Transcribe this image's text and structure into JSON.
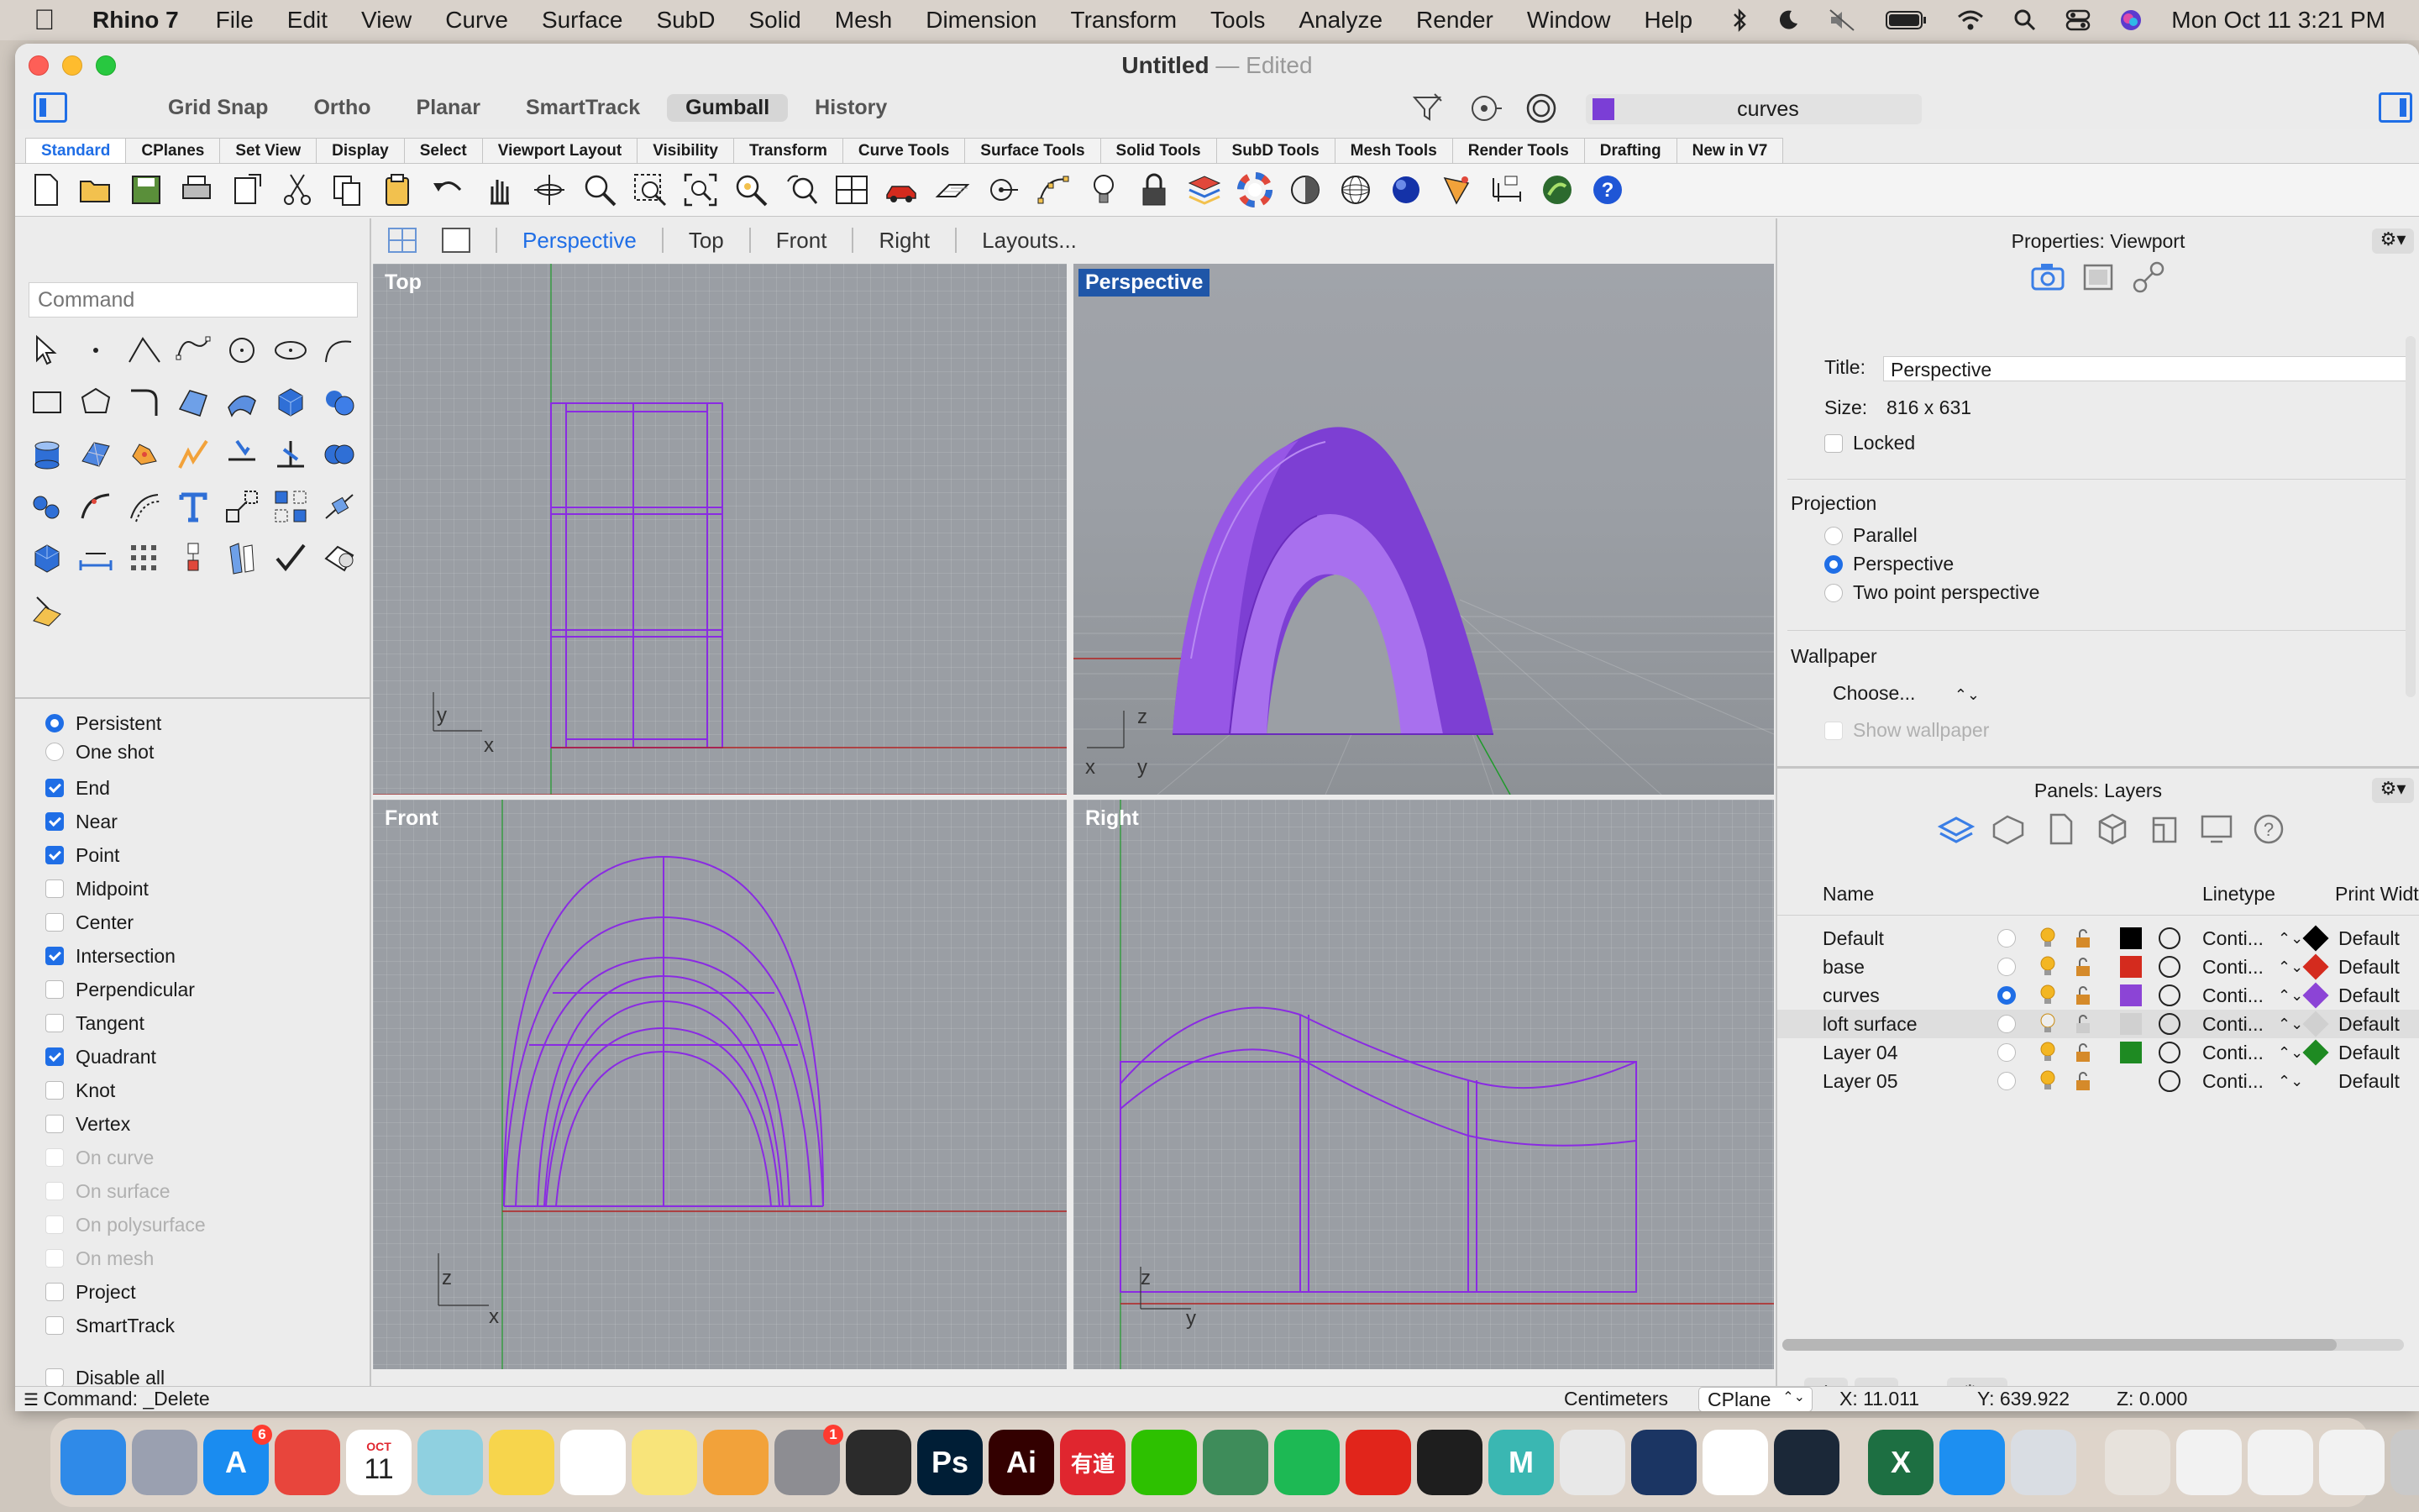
{
  "menubar": {
    "app_name": "Rhino 7",
    "items": [
      "File",
      "Edit",
      "View",
      "Curve",
      "Surface",
      "SubD",
      "Solid",
      "Mesh",
      "Dimension",
      "Transform",
      "Tools",
      "Analyze",
      "Render",
      "Window",
      "Help"
    ],
    "clock": "Mon Oct 11  3:21 PM"
  },
  "window": {
    "title": "Untitled",
    "edited": "— Edited",
    "toggles": [
      {
        "label": "Grid Snap",
        "active": false
      },
      {
        "label": "Ortho",
        "active": false
      },
      {
        "label": "Planar",
        "active": false
      },
      {
        "label": "SmartTrack",
        "active": false
      },
      {
        "label": "Gumball",
        "active": true
      },
      {
        "label": "History",
        "active": false
      }
    ],
    "current_layer": "curves",
    "current_layer_color": "#7b3ed6"
  },
  "tabs": [
    "Standard",
    "CPlanes",
    "Set View",
    "Display",
    "Select",
    "Viewport Layout",
    "Visibility",
    "Transform",
    "Curve Tools",
    "Surface Tools",
    "Solid Tools",
    "SubD Tools",
    "Mesh Tools",
    "Render Tools",
    "Drafting",
    "New in V7"
  ],
  "active_tab": "Standard",
  "command": {
    "placeholder": "Command",
    "last_command": "Command: _Delete"
  },
  "osnap": {
    "mode": [
      {
        "label": "Persistent",
        "on": true
      },
      {
        "label": "One shot",
        "on": false
      }
    ],
    "items": [
      {
        "label": "End",
        "on": true,
        "disabled": false
      },
      {
        "label": "Near",
        "on": true,
        "disabled": false
      },
      {
        "label": "Point",
        "on": true,
        "disabled": false
      },
      {
        "label": "Midpoint",
        "on": false,
        "disabled": false
      },
      {
        "label": "Center",
        "on": false,
        "disabled": false
      },
      {
        "label": "Intersection",
        "on": true,
        "disabled": false
      },
      {
        "label": "Perpendicular",
        "on": false,
        "disabled": false
      },
      {
        "label": "Tangent",
        "on": false,
        "disabled": false
      },
      {
        "label": "Quadrant",
        "on": true,
        "disabled": false
      },
      {
        "label": "Knot",
        "on": false,
        "disabled": false
      },
      {
        "label": "Vertex",
        "on": false,
        "disabled": false
      },
      {
        "label": "On curve",
        "on": false,
        "disabled": true
      },
      {
        "label": "On surface",
        "on": false,
        "disabled": true
      },
      {
        "label": "On polysurface",
        "on": false,
        "disabled": true
      },
      {
        "label": "On mesh",
        "on": false,
        "disabled": true
      },
      {
        "label": "Project",
        "on": false,
        "disabled": false
      },
      {
        "label": "SmartTrack",
        "on": false,
        "disabled": false
      }
    ],
    "disable_all": "Disable all"
  },
  "viewport_tabs": {
    "items": [
      "Perspective",
      "Top",
      "Front",
      "Right",
      "Layouts..."
    ],
    "active": "Perspective"
  },
  "viewports": {
    "top": {
      "label": "Top",
      "axis_a": "y",
      "axis_b": "x"
    },
    "perspective": {
      "label": "Perspective",
      "axis_a": "z",
      "axis_b": "x",
      "axis_c": "y"
    },
    "front": {
      "label": "Front",
      "axis_a": "z",
      "axis_b": "x"
    },
    "right": {
      "label": "Right",
      "axis_a": "z",
      "axis_b": "y"
    }
  },
  "properties": {
    "panel_title": "Properties: Viewport",
    "title_label": "Title:",
    "title_value": "Perspective",
    "size_label": "Size:",
    "size_value": "816 x 631",
    "locked_label": "Locked",
    "projection_label": "Projection",
    "projection_options": [
      {
        "label": "Parallel",
        "on": false
      },
      {
        "label": "Perspective",
        "on": true
      },
      {
        "label": "Two point perspective",
        "on": false
      }
    ],
    "wallpaper_label": "Wallpaper",
    "wallpaper_choose": "Choose...",
    "show_wallpaper": "Show wallpaper"
  },
  "layers": {
    "panel_title": "Panels: Layers",
    "headers": {
      "name": "Name",
      "linetype": "Linetype",
      "print_width": "Print Width"
    },
    "rows": [
      {
        "name": "Default",
        "current": false,
        "color": "#000000",
        "linetype": "Conti...",
        "print_color": "#000000",
        "print_width": "Default",
        "selected": false
      },
      {
        "name": "base",
        "current": false,
        "color": "#d42b1e",
        "linetype": "Conti...",
        "print_color": "#d42b1e",
        "print_width": "Default",
        "selected": false
      },
      {
        "name": "curves",
        "current": true,
        "color": "#8c44d6",
        "linetype": "Conti...",
        "print_color": "#8c44d6",
        "print_width": "Default",
        "selected": false
      },
      {
        "name": "loft surface",
        "current": false,
        "color": "#d0d0d0",
        "linetype": "Conti...",
        "print_color": "#d0d0d0",
        "print_width": "Default",
        "selected": true
      },
      {
        "name": "Layer 04",
        "current": false,
        "color": "#1e8a22",
        "linetype": "Conti...",
        "print_color": "#1e8a22",
        "print_width": "Default",
        "selected": false
      },
      {
        "name": "Layer 05",
        "current": false,
        "color": "#ffffff",
        "linetype": "Conti...",
        "print_color": "#ffffff",
        "print_width": "Default",
        "selected": false
      }
    ],
    "add": "+",
    "remove": "−",
    "gear": "⚙ ▾"
  },
  "status": {
    "units": "Centimeters",
    "cplane": "CPlane",
    "x": "X: 11.011",
    "y": "Y: 639.922",
    "z": "Z: 0.000"
  },
  "dock": {
    "calendar_month": "OCT",
    "calendar_day": "11",
    "appstore_badge": "6",
    "settings_badge": "1",
    "apps": [
      {
        "name": "finder",
        "color": "#2f8ae8",
        "glyph": ""
      },
      {
        "name": "launchpad",
        "color": "#9aa0b0",
        "glyph": ""
      },
      {
        "name": "app-store",
        "color": "#1a8cf0",
        "glyph": "A"
      },
      {
        "name": "chrome",
        "color": "#e8453c",
        "glyph": ""
      },
      {
        "name": "calendar",
        "color": "#ffffff",
        "glyph": ""
      },
      {
        "name": "rhino",
        "color": "#8fd0e0",
        "glyph": ""
      },
      {
        "name": "notes",
        "color": "#f7d54c",
        "glyph": ""
      },
      {
        "name": "reminders",
        "color": "#ffffff",
        "glyph": ""
      },
      {
        "name": "stickies",
        "color": "#f8e47a",
        "glyph": ""
      },
      {
        "name": "pages",
        "color": "#f2a23a",
        "glyph": ""
      },
      {
        "name": "system-preferences",
        "color": "#8d8d92",
        "glyph": ""
      },
      {
        "name": "final-cut",
        "color": "#2b2b2b",
        "glyph": ""
      },
      {
        "name": "photoshop",
        "color": "#001e36",
        "glyph": "Ps"
      },
      {
        "name": "illustrator",
        "color": "#330000",
        "glyph": "Ai"
      },
      {
        "name": "youdao",
        "color": "#e0262f",
        "glyph": "有道"
      },
      {
        "name": "wechat",
        "color": "#2dc100",
        "glyph": ""
      },
      {
        "name": "grasshopper",
        "color": "#3e8c5a",
        "glyph": ""
      },
      {
        "name": "spotify",
        "color": "#1db954",
        "glyph": ""
      },
      {
        "name": "netease-music",
        "color": "#e1251b",
        "glyph": ""
      },
      {
        "name": "figma",
        "color": "#1e1e1e",
        "glyph": ""
      },
      {
        "name": "maya",
        "color": "#3ab7b2",
        "glyph": "M"
      },
      {
        "name": "unity",
        "color": "#e8e8e8",
        "glyph": ""
      },
      {
        "name": "cinema4d",
        "color": "#1b3563",
        "glyph": ""
      },
      {
        "name": "slack",
        "color": "#ffffff",
        "glyph": ""
      },
      {
        "name": "steam",
        "color": "#1b2838",
        "glyph": ""
      },
      {
        "name": "excel",
        "color": "#1d6f42",
        "glyph": "X"
      },
      {
        "name": "safari",
        "color": "#1d8ff1",
        "glyph": ""
      },
      {
        "name": "preview",
        "color": "#d9dde3",
        "glyph": ""
      },
      {
        "name": "downloads-stack",
        "color": "#e7e2dc",
        "glyph": ""
      },
      {
        "name": "document-stack-1",
        "color": "#f2f2f2",
        "glyph": ""
      },
      {
        "name": "document-stack-2",
        "color": "#f2f2f2",
        "glyph": ""
      },
      {
        "name": "document-stack-3",
        "color": "#f2f2f2",
        "glyph": ""
      },
      {
        "name": "trash",
        "color": "#c9c9c9",
        "glyph": ""
      }
    ]
  }
}
